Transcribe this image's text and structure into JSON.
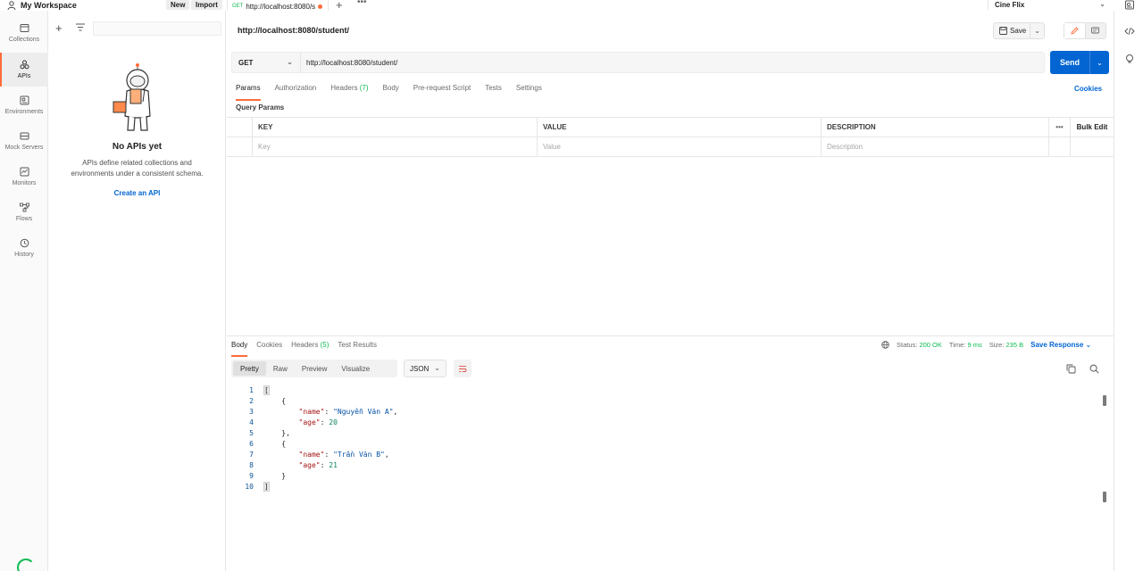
{
  "topbar": {
    "workspace": "My Workspace",
    "new_label": "New",
    "import_label": "Import",
    "tab": {
      "method": "GET",
      "label": "http://localhost:8080/s"
    },
    "environment": "Cine Flix"
  },
  "rail": {
    "items": [
      {
        "label": "Collections",
        "icon": "collections-icon"
      },
      {
        "label": "APIs",
        "icon": "apis-icon"
      },
      {
        "label": "Environments",
        "icon": "environments-icon"
      },
      {
        "label": "Mock Servers",
        "icon": "mock-servers-icon"
      },
      {
        "label": "Monitors",
        "icon": "monitors-icon"
      },
      {
        "label": "Flows",
        "icon": "flows-icon"
      },
      {
        "label": "History",
        "icon": "history-icon"
      }
    ]
  },
  "panel": {
    "empty_title": "No APIs yet",
    "empty_desc": "APIs define related collections and environments under a consistent schema.",
    "create_link": "Create an API"
  },
  "request": {
    "title": "http://localhost:8080/student/",
    "save_label": "Save",
    "method": "GET",
    "url": "http://localhost:8080/student/",
    "send_label": "Send",
    "tabs": [
      {
        "label": "Params",
        "count": ""
      },
      {
        "label": "Authorization",
        "count": ""
      },
      {
        "label": "Headers",
        "count": "(7)"
      },
      {
        "label": "Body",
        "count": ""
      },
      {
        "label": "Pre-request Script",
        "count": ""
      },
      {
        "label": "Tests",
        "count": ""
      },
      {
        "label": "Settings",
        "count": ""
      }
    ],
    "cookies_label": "Cookies",
    "query_params_title": "Query Params",
    "table": {
      "headers": [
        "KEY",
        "VALUE",
        "DESCRIPTION"
      ],
      "bulk_edit": "Bulk Edit",
      "placeholders": [
        "Key",
        "Value",
        "Description"
      ]
    }
  },
  "response": {
    "tabs": [
      {
        "label": "Body",
        "count": ""
      },
      {
        "label": "Cookies",
        "count": ""
      },
      {
        "label": "Headers",
        "count": "(5)"
      },
      {
        "label": "Test Results",
        "count": ""
      }
    ],
    "status_label": "Status:",
    "status_value": "200 OK",
    "time_label": "Time:",
    "time_value": "9 ms",
    "size_label": "Size:",
    "size_value": "235 B",
    "save_response": "Save Response",
    "formats": [
      "Pretty",
      "Raw",
      "Preview",
      "Visualize"
    ],
    "language": "JSON",
    "code_lines": [
      {
        "n": "1",
        "text": "["
      },
      {
        "n": "2",
        "text": "    {"
      },
      {
        "n": "3",
        "key": "\"name\"",
        "val": "\"Nguyễn Văn A\"",
        "tail": ","
      },
      {
        "n": "4",
        "key": "\"age\"",
        "num": "20",
        "tail": ""
      },
      {
        "n": "5",
        "text": "    },"
      },
      {
        "n": "6",
        "text": "    {"
      },
      {
        "n": "7",
        "key": "\"name\"",
        "val": "\"Trần Văn B\"",
        "tail": ","
      },
      {
        "n": "8",
        "key": "\"age\"",
        "num": "21",
        "tail": ""
      },
      {
        "n": "9",
        "text": "    }"
      },
      {
        "n": "10",
        "text": "]"
      }
    ]
  },
  "colors": {
    "accent": "#ff6c37",
    "primary": "#0265d2",
    "success": "#0cbb52"
  }
}
